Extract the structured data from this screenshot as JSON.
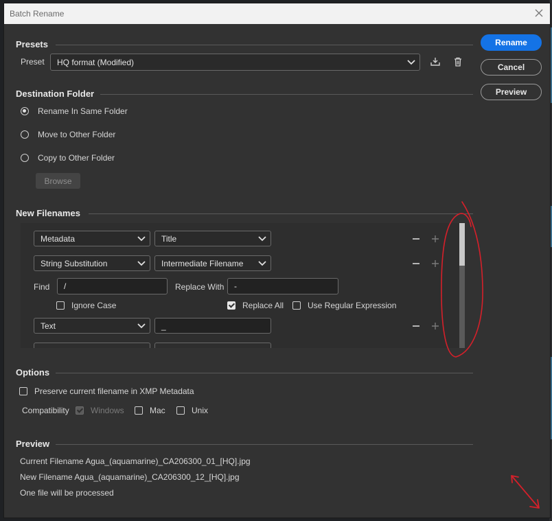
{
  "dialog": {
    "title": "Batch Rename"
  },
  "actions": {
    "rename": "Rename",
    "cancel": "Cancel",
    "preview": "Preview"
  },
  "presets": {
    "section_title": "Presets",
    "label": "Preset",
    "selected": "HQ format (Modified)"
  },
  "destination": {
    "section_title": "Destination Folder",
    "options": [
      "Rename In Same Folder",
      "Move to Other Folder",
      "Copy to Other Folder"
    ],
    "selected_index": 0,
    "browse_label": "Browse"
  },
  "new_filenames": {
    "section_title": "New Filenames",
    "rows": [
      {
        "type": "Metadata",
        "value": "Title"
      },
      {
        "type": "String Substitution",
        "value": "Intermediate Filename"
      },
      {
        "type": "Text",
        "value": "_"
      }
    ],
    "find_label": "Find",
    "find_value": "/",
    "replace_label": "Replace With",
    "replace_value": "-",
    "ignore_case": {
      "label": "Ignore Case",
      "checked": false
    },
    "replace_all": {
      "label": "Replace All",
      "checked": true
    },
    "use_regex": {
      "label": "Use Regular Expression",
      "checked": false
    }
  },
  "options": {
    "section_title": "Options",
    "preserve": {
      "label": "Preserve current filename in XMP Metadata",
      "checked": false
    },
    "compat_label": "Compatibility",
    "windows": {
      "label": "Windows",
      "checked": true,
      "disabled": true
    },
    "mac": {
      "label": "Mac",
      "checked": false
    },
    "unix": {
      "label": "Unix",
      "checked": false
    }
  },
  "preview": {
    "section_title": "Preview",
    "current_line": "Current Filename Agua_(aquamarine)_CA206300_01_[HQ].jpg",
    "new_line": "New Filename Agua_(aquamarine)_CA206300_12_[HQ].jpg",
    "count_line": "One file will be processed"
  },
  "colors": {
    "accent": "#1473e6",
    "annotation": "#d6202a"
  }
}
